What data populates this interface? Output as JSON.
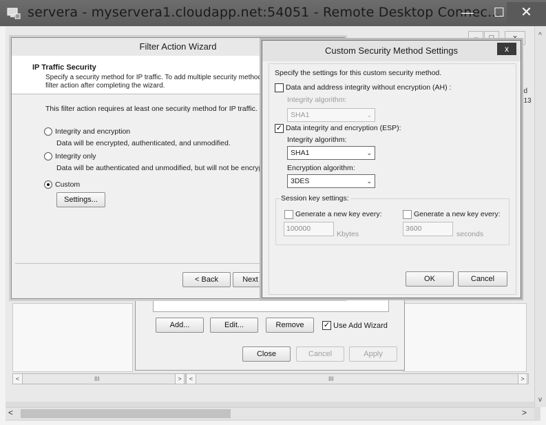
{
  "window": {
    "title": "servera - myservera1.cloudapp.net:54051 - Remote Desktop Connec...",
    "minimize_glyph": "—",
    "maximize_glyph": "☐",
    "close_glyph": "✕",
    "icon": "remote-desktop-icon"
  },
  "background_window": {
    "min_glyph": "–",
    "max_glyph": "□",
    "close_glyph": "x",
    "column_header_fragment": "ed\n013"
  },
  "filter_list_dialog": {
    "add_label": "Add...",
    "edit_label": "Edit...",
    "remove_label": "Remove",
    "use_add_wizard_label": "Use Add Wizard",
    "use_add_wizard_checked": true,
    "close_label": "Close",
    "cancel_label": "Cancel",
    "apply_label": "Apply"
  },
  "scrollbars": {
    "grip": "III",
    "left_arrow": "<",
    "right_arrow": ">",
    "up_arrow": "^",
    "down_arrow": "v"
  },
  "wizard": {
    "title": "Filter Action Wizard",
    "heading": "IP Traffic Security",
    "description_line1": "Specify a security method for IP traffic. To add multiple security methods",
    "description_line2": "filter action after completing the wizard.",
    "intro": "This filter action requires at least one security method for IP traffic.",
    "options": [
      {
        "label": "Integrity and encryption",
        "description": "Data will be encrypted, authenticated, and unmodified.",
        "selected": false
      },
      {
        "label": "Integrity only",
        "description": "Data will be authenticated and unmodified, but will not be encrypted.",
        "selected": false
      },
      {
        "label": "Custom",
        "description": "",
        "selected": true
      }
    ],
    "settings_label": "Settings...",
    "back_label": "< Back",
    "next_label": "Next"
  },
  "custom_security": {
    "title": "Custom Security Method Settings",
    "close_glyph": "x",
    "intro": "Specify the settings for this custom security method.",
    "ah": {
      "label": "Data and address integrity without encryption (AH) :",
      "checked": false,
      "integrity_label": "Integrity algorithm:",
      "integrity_value": "SHA1"
    },
    "esp": {
      "label": "Data integrity and encryption (ESP):",
      "checked": true,
      "integrity_label": "Integrity algorithm:",
      "integrity_value": "SHA1",
      "encryption_label": "Encryption algorithm:",
      "encryption_value": "3DES"
    },
    "session": {
      "group_label": "Session key settings:",
      "kbytes_check_label": "Generate a new key every:",
      "kbytes_checked": false,
      "kbytes_value": "100000",
      "kbytes_unit": "Kbytes",
      "seconds_check_label": "Generate a new key every:",
      "seconds_checked": false,
      "seconds_value": "3600",
      "seconds_unit": "seconds"
    },
    "ok_label": "OK",
    "cancel_label": "Cancel"
  },
  "colors": {
    "rdp_titlebar": "#5e5e5e",
    "dialog_bg": "#f0f0f0"
  }
}
